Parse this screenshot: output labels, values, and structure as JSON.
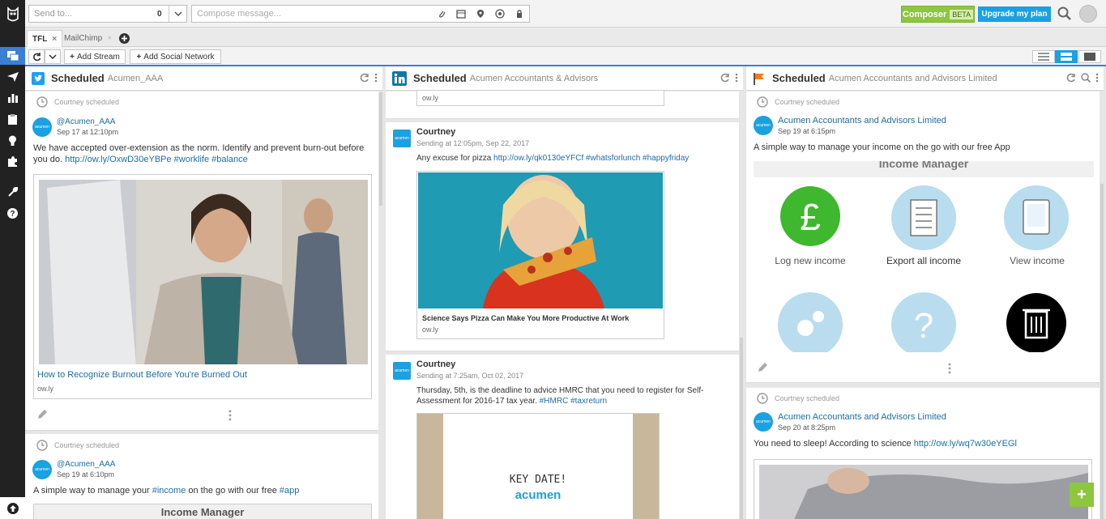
{
  "topbar": {
    "send_to_placeholder": "Send to...",
    "send_to_count": "0",
    "compose_placeholder": "Compose message...",
    "composer_label": "Composer",
    "composer_badge": "BETA",
    "upgrade_label": "Upgrade my plan"
  },
  "tabs": [
    {
      "label": "TFL",
      "close": "×"
    },
    {
      "label": "MailChimp",
      "close": "×"
    }
  ],
  "toolbar": {
    "add_stream": "Add Stream",
    "add_social_network": "Add Social Network"
  },
  "colors": {
    "accent": "#1aa1e1",
    "green": "#8dc63f",
    "sidebar": "#222222",
    "link": "#1d6da8"
  },
  "columns": [
    {
      "title": "Scheduled",
      "subtitle": "Acumen_AAA",
      "network": "twitter",
      "cards": [
        {
          "scheduled_by": "Courtney scheduled",
          "handle": "@Acumen_AAA",
          "time": "Sep 17 at 12:10pm",
          "text": "We have accepted over-extension as the norm. Identify and prevent burn-out before you do.",
          "link": "http://ow.ly/OxwD30eYBPe",
          "tags": "#worklife #balance",
          "link_title": "How to Recognize Burnout Before You're Burned Out",
          "link_domain": "ow.ly"
        },
        {
          "scheduled_by": "Courtney scheduled",
          "handle": "@Acumen_AAA",
          "time": "Sep 19 at 6:10pm",
          "text_before": "A simple way to manage your",
          "tag1": "#income",
          "text_mid": "on the go with our free",
          "tag2": "#app",
          "image_heading": "Income Manager"
        }
      ]
    },
    {
      "title": "Scheduled",
      "subtitle": "Acumen Accountants & Advisors",
      "network": "linkedin",
      "cards": [
        {
          "link_domain": "ow.ly"
        },
        {
          "name": "Courtney",
          "sending": "Sending at 12:05pm, Sep 22, 2017",
          "text": "Any excuse for pizza",
          "link": "http://ow.ly/qk0130eYFCf",
          "tags": "#whatsforlunch #happyfriday",
          "link_title": "Science Says Pizza Can Make You More Productive At Work",
          "link_domain": "ow.ly"
        },
        {
          "name": "Courtney",
          "sending": "Sending at 7:25am, Oct 02, 2017",
          "text": "Thursday, 5th, is the deadline to advice HMRC that you need to register for Self-Assessment for 2016-17 tax year.",
          "tags": "#HMRC #taxreturn",
          "image_text1": "KEY DATE!",
          "image_text2": "acumen"
        }
      ]
    },
    {
      "title": "Scheduled",
      "subtitle": "Acumen Accountants and Advisors Limited",
      "network": "facebook-page",
      "cards": [
        {
          "scheduled_by": "Courtney scheduled",
          "handle": "Acumen Accountants and Advisors Limited",
          "time": "Sep 19 at 6:15pm",
          "text": "A simple way to manage your income on the go with our free App",
          "image_heading": "Income Manager",
          "labels": [
            "Log new income",
            "Export all income",
            "View income"
          ]
        },
        {
          "scheduled_by": "Courtney scheduled",
          "handle": "Acumen Accountants and Advisors Limited",
          "time": "Sep 20 at 8:25pm",
          "text": "You need to sleep! According to science",
          "link": "http://ow.ly/wq7w30eYEGl"
        }
      ]
    }
  ],
  "fab_label": "+"
}
